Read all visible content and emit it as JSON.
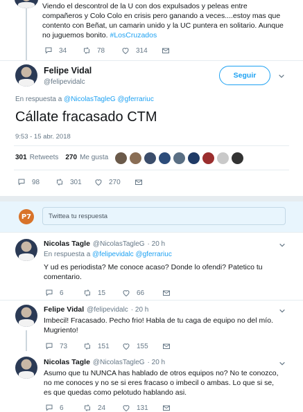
{
  "top_tweet": {
    "text": "Viendo el descontrol de la U con dos expulsados y peleas entre compañeros y Colo Colo en crisis pero ganando a veces....estoy mas que contento con Beñat, un camarin unido y la UC puntera en solitario. Aunque no juguemos bonito.",
    "hashtag": "#LosCruzados",
    "replies": "34",
    "retweets": "78",
    "likes": "314"
  },
  "main_tweet": {
    "name": "Felipe Vidal",
    "handle": "@felipevidalc",
    "follow_label": "Seguir",
    "reply_prefix": "En respuesta a",
    "reply_to": "@NicolasTagleG @gferrariuc",
    "text": "Cállate fracasado CTM",
    "timestamp": "9:53 - 15 abr. 2018",
    "retweets_count": "301",
    "retweets_label": "Retweets",
    "likes_count": "270",
    "likes_label": "Me gusta",
    "replies": "98",
    "retweets": "301",
    "likes": "270"
  },
  "reply_box": {
    "logo": "P7",
    "placeholder": "Twittea tu respuesta"
  },
  "replies": [
    {
      "name": "Nicolas Tagle",
      "handle": "@NicolasTagleG",
      "time": "· 20 h",
      "reply_prefix": "En respuesta a",
      "reply_to": "@felipevidalc @gferrariuc",
      "text": "Y ud es periodista? Me conoce acaso? Donde lo ofendi? Patetico tu comentario.",
      "replies": "6",
      "retweets": "15",
      "likes": "66"
    },
    {
      "name": "Felipe Vidal",
      "handle": "@felipevidalc",
      "time": "· 20 h",
      "text": "Imbecil! Fracasado. Pecho frio! Habla de tu caga de equipo no del mío. Mugriento!",
      "replies": "73",
      "retweets": "151",
      "likes": "155"
    },
    {
      "name": "Nicolas Tagle",
      "handle": "@NicolasTagleG",
      "time": "· 20 h",
      "text": "Asumo que tu NUNCA has hablado de otros equipos no? No te conozco, no me conoces y no se si eres fracaso o imbecil o ambas. Lo que si se, es que quedas como pelotudo hablando asi.",
      "replies": "6",
      "retweets": "24",
      "likes": "131"
    }
  ],
  "colors": {
    "accent": "#1da1f2",
    "like_red": "#e0245e",
    "muted": "#657786"
  },
  "likers_colors": [
    "#6b5a4a",
    "#8a6e55",
    "#3b4d6b",
    "#2c4c7a",
    "#5a6f84",
    "#1f3a66",
    "#9b2e2e",
    "#c9c9c9",
    "#333333"
  ]
}
